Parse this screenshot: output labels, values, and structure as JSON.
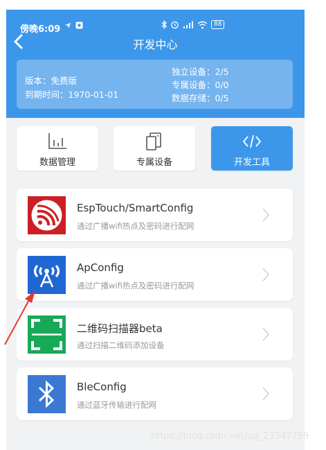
{
  "status_bar": {
    "time": "傍晚6:09",
    "battery": "88"
  },
  "nav": {
    "title": "开发中心"
  },
  "plan": {
    "version_label": "版本：",
    "version_value": "免费版",
    "expire_label": "到期时间：",
    "expire_value": "1970-01-01",
    "stats": [
      {
        "label": "独立设备：",
        "value": "2/5"
      },
      {
        "label": "专属设备：",
        "value": "0/0"
      },
      {
        "label": "数据存储：",
        "value": "0/5"
      }
    ]
  },
  "tabs": [
    {
      "label": "数据管理",
      "icon": "bar-chart-icon",
      "active": false
    },
    {
      "label": "专属设备",
      "icon": "devices-icon",
      "active": false
    },
    {
      "label": "开发工具",
      "icon": "code-icon",
      "active": true
    }
  ],
  "config_items": [
    {
      "title": "EspTouch/SmartConfig",
      "subtitle": "通过广播wifi热点及密码进行配网",
      "icon": "espressif-logo-icon",
      "color": "#cc1f25"
    },
    {
      "title": "ApConfig",
      "subtitle": "通过广播wifi热点及密码进行配网",
      "icon": "ap-antenna-icon",
      "color": "#1f67d2"
    },
    {
      "title": "二维码扫描器beta",
      "subtitle": "通过扫描二维码添加设备",
      "icon": "qr-scan-icon",
      "color": "#18a957"
    },
    {
      "title": "BleConfig",
      "subtitle": "通过蓝牙传输进行配网",
      "icon": "bluetooth-icon",
      "color": "#3a78d4"
    }
  ],
  "watermark": "https://blog.csdn.net/qq_23347759",
  "colors": {
    "primary": "#3c97ea",
    "card": "#75b4ef",
    "annotation": "#e53935"
  }
}
